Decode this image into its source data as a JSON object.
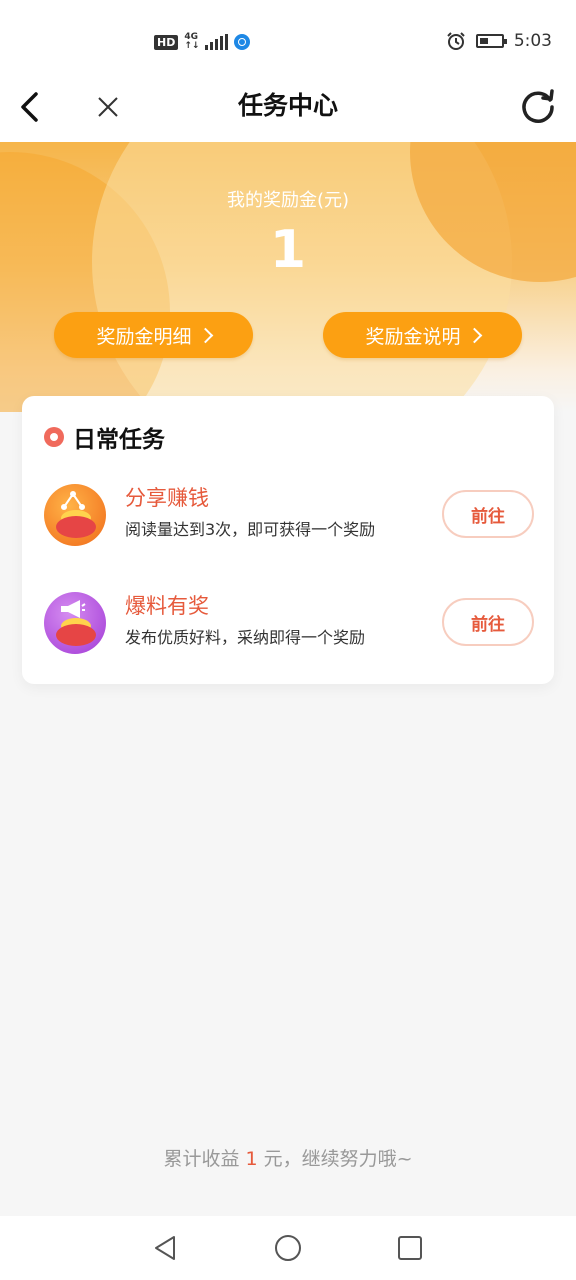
{
  "status_bar": {
    "hd": "HD",
    "network": "4G",
    "network_sub": "↑↓",
    "time": "5:03",
    "icons": [
      "hd-icon",
      "signal-icon",
      "vpn-globe-icon",
      "alarm-icon",
      "battery-icon"
    ]
  },
  "header": {
    "title": "任务中心",
    "icons": [
      "back-icon",
      "close-icon",
      "refresh-icon"
    ]
  },
  "hero": {
    "label": "我的奖励金(元)",
    "value": "1",
    "buttons": [
      {
        "label": "奖励金明细"
      },
      {
        "label": "奖励金说明"
      }
    ]
  },
  "tasks_card": {
    "title": "日常任务",
    "items": [
      {
        "name": "分享赚钱",
        "desc": "阅读量达到3次，即可获得一个奖励",
        "action": "前往",
        "icon": "share-coins-icon"
      },
      {
        "name": "爆料有奖",
        "desc": "发布优质好料，采纳即得一个奖励",
        "action": "前往",
        "icon": "megaphone-coins-icon"
      }
    ]
  },
  "footer": {
    "prefix": "累计收益 ",
    "amount": "1",
    "suffix": " 元，继续努力哦~"
  },
  "nav": {
    "icons": [
      "back-triangle-icon",
      "home-circle-icon",
      "recents-square-icon"
    ]
  },
  "colors": {
    "accent": "#fca012",
    "task_text": "#e65a3c",
    "hero_top": "#f6b54a"
  }
}
